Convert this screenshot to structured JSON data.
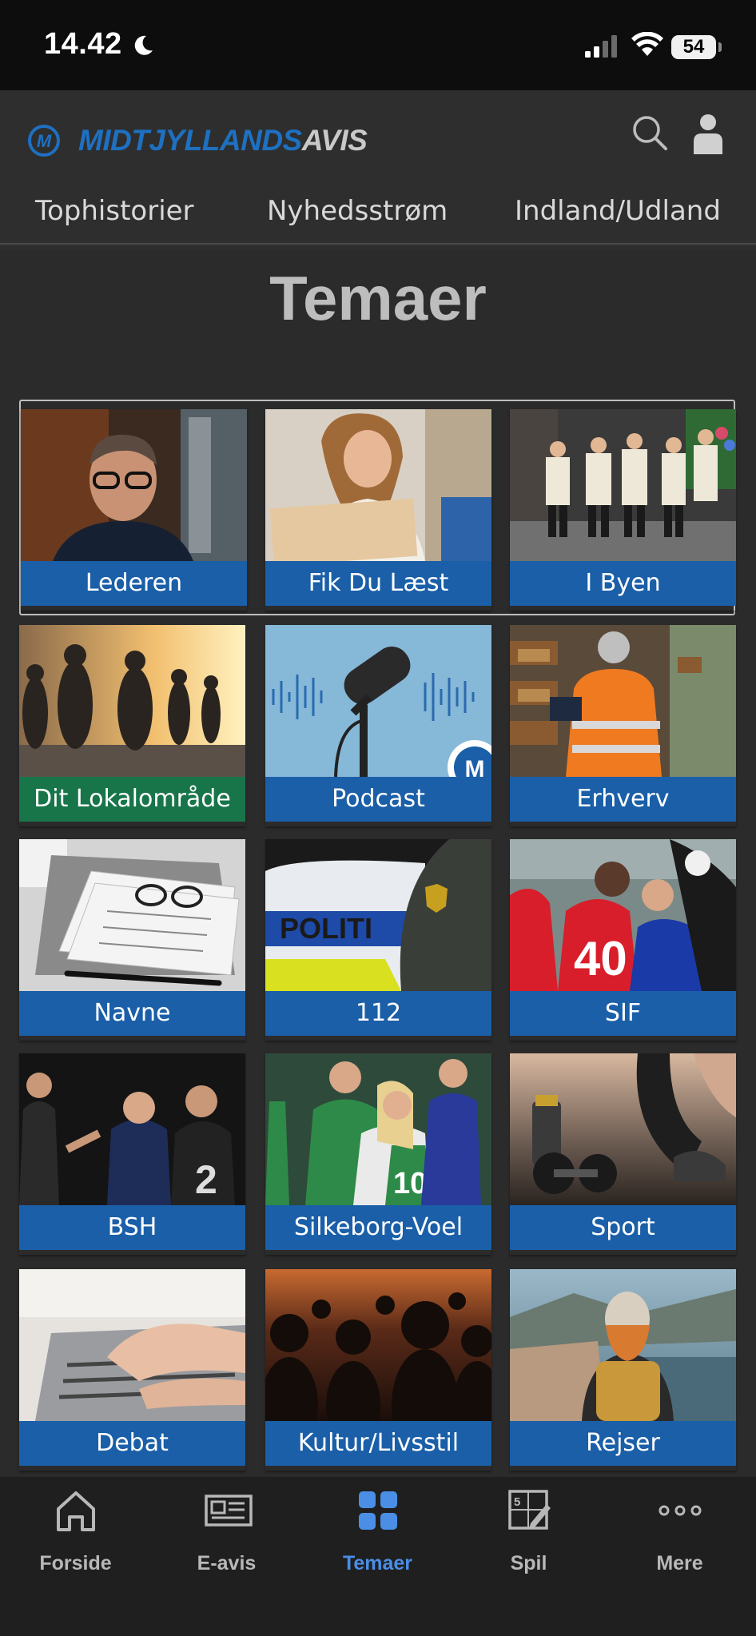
{
  "status_bar": {
    "time": "14.42",
    "battery": "54",
    "icons": [
      "moon-icon",
      "signal-icon",
      "wifi-icon",
      "battery-icon"
    ]
  },
  "header": {
    "logo_part1": "MIDTJYLLANDS",
    "logo_part2": "AVIS",
    "search_icon": "search-icon",
    "user_icon": "user-icon"
  },
  "nav": {
    "items": [
      "Tophistorier",
      "Nyhedsstrøm",
      "Indland/Udland"
    ]
  },
  "page_title": "Temaer",
  "themes": [
    {
      "label": "Lederen"
    },
    {
      "label": "Fik Du Læst"
    },
    {
      "label": "I Byen"
    },
    {
      "label": "Dit Lokalområde"
    },
    {
      "label": "Podcast"
    },
    {
      "label": "Erhverv"
    },
    {
      "label": "Navne"
    },
    {
      "label": "112"
    },
    {
      "label": "SIF"
    },
    {
      "label": "BSH"
    },
    {
      "label": "Silkeborg-Voel"
    },
    {
      "label": "Sport"
    },
    {
      "label": "Debat"
    },
    {
      "label": "Kultur/Livsstil"
    },
    {
      "label": "Rejser"
    }
  ],
  "podcast_badge": "M",
  "police_text": "POLITI",
  "tabbar": {
    "items": [
      {
        "label": "Forside",
        "icon": "home-icon"
      },
      {
        "label": "E-avis",
        "icon": "newspaper-icon"
      },
      {
        "label": "Temaer",
        "icon": "grid-icon"
      },
      {
        "label": "Spil",
        "icon": "puzzle-icon"
      },
      {
        "label": "Mere",
        "icon": "more-icon"
      }
    ],
    "active": "Temaer"
  },
  "colors": {
    "accent": "#1a5fa8",
    "green_label": "#18754a",
    "active_tab": "#4a8ee6",
    "background": "#2b2b2b"
  }
}
